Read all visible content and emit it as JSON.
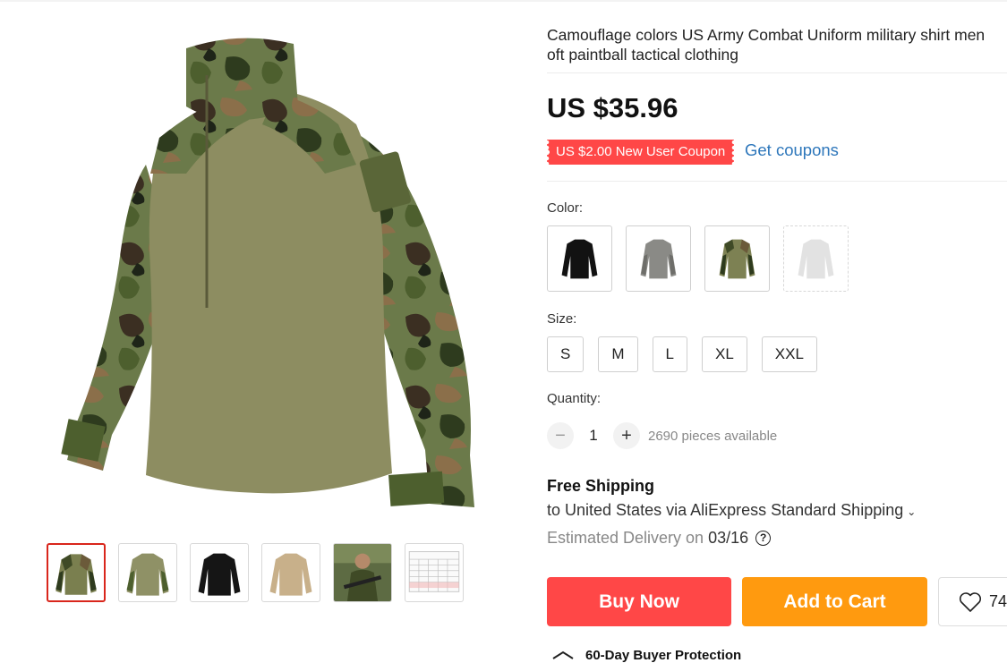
{
  "product": {
    "title": "Camouflage colors US Army Combat Uniform military shirt men\noft paintball tactical clothing",
    "price": "US $35.96",
    "coupon_label": "US $2.00 New User Coupon",
    "get_coupons_link": "Get coupons"
  },
  "gallery": {
    "thumbnails": [
      {
        "icon": "woodland-camo-shirt",
        "selected": true
      },
      {
        "icon": "green-shirt-back"
      },
      {
        "icon": "black-shirt"
      },
      {
        "icon": "khaki-shirt"
      },
      {
        "icon": "soldier-photo"
      },
      {
        "icon": "size-chart"
      }
    ]
  },
  "options": {
    "color_label": "Color:",
    "colors": [
      {
        "icon": "black-shirt"
      },
      {
        "icon": "grey-shirt"
      },
      {
        "icon": "woodland-camo-shirt"
      },
      {
        "icon": "white-shirt",
        "disabled": true
      }
    ],
    "size_label": "Size:",
    "sizes": [
      "S",
      "M",
      "L",
      "XL",
      "XXL"
    ]
  },
  "quantity": {
    "label": "Quantity:",
    "value": "1",
    "available": "2690 pieces available"
  },
  "shipping": {
    "title": "Free Shipping",
    "description": "to United States via AliExpress Standard Shipping",
    "estimated_label": "Estimated Delivery on",
    "estimated_date": "03/16"
  },
  "actions": {
    "buy_now": "Buy Now",
    "add_to_cart": "Add to Cart",
    "wishlist_count": "74"
  },
  "protection": {
    "label": "60-Day Buyer Protection"
  },
  "colors": {
    "accent_red": "#ff4747",
    "accent_orange": "#ff9a0f",
    "link_blue": "#2e77bb",
    "selected_border": "#d9261c"
  }
}
